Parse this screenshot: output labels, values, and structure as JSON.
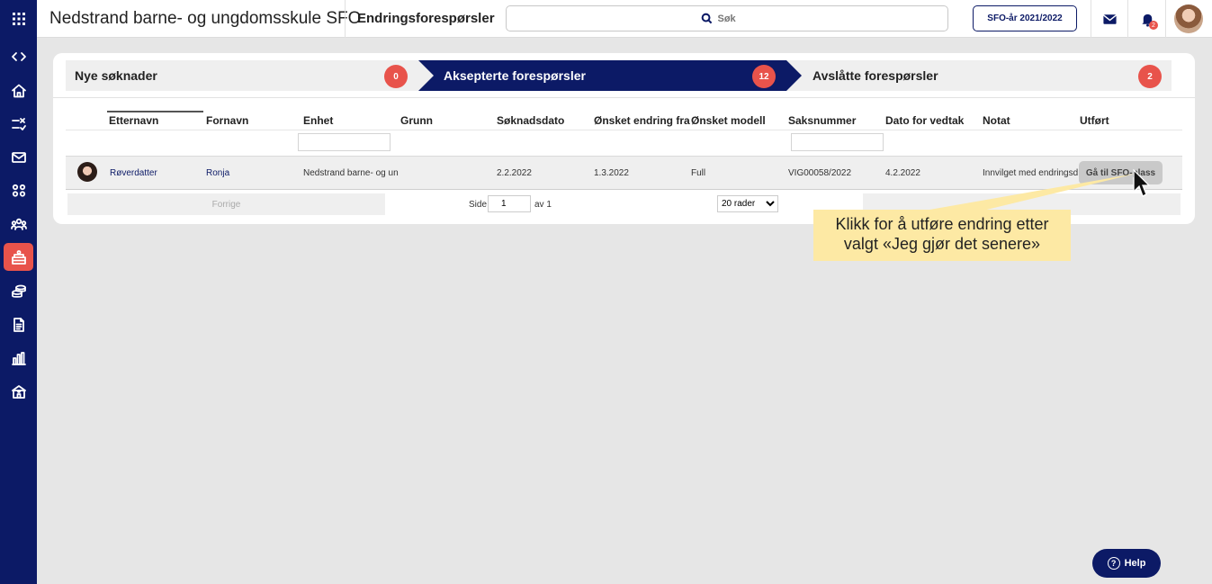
{
  "topbar": {
    "app_title": "Nedstrand barne- og ungdomsskule SFO",
    "page_title": "Endringsforespørsler",
    "search_label": "Søk",
    "year_button": "SFO-år 2021/2022",
    "notification_count": "2"
  },
  "steps": [
    {
      "label": "Nye søknader",
      "count": "0"
    },
    {
      "label": "Aksepterte forespørsler",
      "count": "12"
    },
    {
      "label": "Avslåtte forespørsler",
      "count": "2"
    }
  ],
  "table": {
    "columns": [
      "Etternavn",
      "Fornavn",
      "Enhet",
      "Grunn",
      "Søknadsdato",
      "Ønsket endring fra",
      "Ønsket modell",
      "Saksnummer",
      "Dato for vedtak",
      "Notat",
      "Utført"
    ],
    "rows": [
      {
        "etternavn": "Røverdatter",
        "fornavn": "Ronja",
        "enhet": "Nedstrand barne- og un",
        "grunn": "",
        "soknadsdato": "2.2.2022",
        "onsket_endring_fra": "1.3.2022",
        "onsket_modell": "Full",
        "saksnummer": "VIG00058/2022",
        "dato_for_vedtak": "4.2.2022",
        "notat": "Innvilget med endringsd",
        "action": "Gå til SFO-plass"
      }
    ]
  },
  "pagination": {
    "previous": "Forrige",
    "page_label": "Side",
    "page_value": "1",
    "of_label": "av 1",
    "rows_option": "20 rader"
  },
  "callout": {
    "line1": "Klikk for å utføre endring etter",
    "line2": "valgt «Jeg gjør det senere»"
  },
  "help": {
    "label": "Help"
  },
  "colors": {
    "sidebar": "#0c1a66",
    "accent": "#e8534b",
    "active_step": "#0c1a66",
    "inactive_step": "#efefef",
    "callout": "#fde9a4"
  },
  "sidebar_icons": [
    "apps-grid-icon",
    "code-toggle-icon",
    "home-icon",
    "changes-icon",
    "mail-icon",
    "children-icon",
    "groups-icon",
    "sfo-icon",
    "payments-icon",
    "document-icon",
    "statistics-icon",
    "school-icon"
  ]
}
